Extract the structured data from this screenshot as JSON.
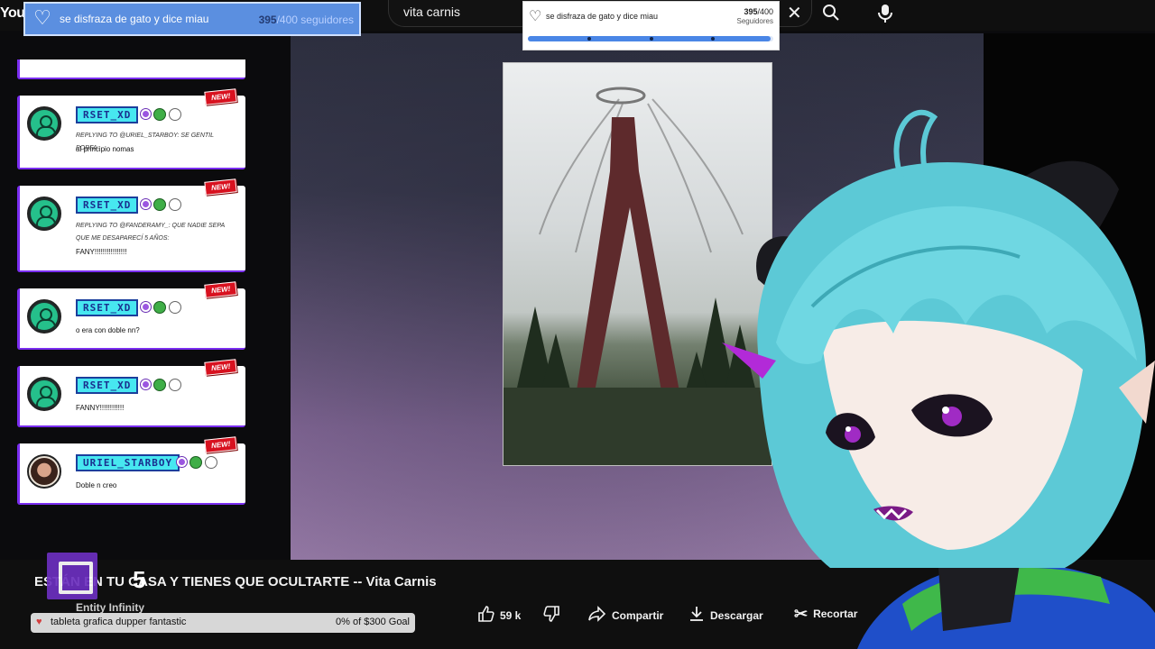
{
  "topbar": {
    "logo": "You",
    "search_value": "vita carnis"
  },
  "follower_goal_banner": {
    "title": "se disfraza de gato y dice miau",
    "current": "395",
    "target": "/400 seguidores"
  },
  "follower_goal_card": {
    "title": "se disfraza de gato y dice miau",
    "current": "395",
    "target": "/400",
    "label": "Seguidores",
    "progress": 0.9875
  },
  "chat": {
    "messages": [
      {
        "user": "RSET_XD",
        "tag": "NEW!",
        "reply": "REPLYING TO @URIEL_STARBOY: SE GENTIL PORFA:",
        "text": "al principio nomas"
      },
      {
        "user": "RSET_XD",
        "tag": "NEW!",
        "reply": "REPLYING TO @FANDERAMY_: QUE NADIE SEPA QUE ME DESAPARECÍ 5 AÑOS:",
        "text": "FANY!!!!!!!!!!!!!!!!"
      },
      {
        "user": "RSET_XD",
        "tag": "NEW!",
        "reply": "",
        "text": "o era con doble nn?"
      },
      {
        "user": "RSET_XD",
        "tag": "NEW!",
        "reply": "",
        "text": "FANNY!!!!!!!!!!!!"
      },
      {
        "user": "URIEL_STARBOY",
        "tag": "NEW!",
        "reply": "",
        "text": "Doble n creo"
      }
    ]
  },
  "video": {
    "title": "ESTÁN EN TU CASA Y TIENES QUE OCULTARTE -- Vita Carnis",
    "channel": "Entity Infinity",
    "overlay_count": "5"
  },
  "tip_goal": {
    "text": "tableta grafica dupper fantastic",
    "progress": "0% of $300 Goal"
  },
  "actions": {
    "likes": "59 k",
    "share": "Compartir",
    "download": "Descargar",
    "clip": "Recortar"
  },
  "colors": {
    "chat_accent": "#7a2df0",
    "username_bg": "#47e7f0",
    "new_tag": "#d8111f",
    "goal_blue": "#5b8fe0"
  }
}
